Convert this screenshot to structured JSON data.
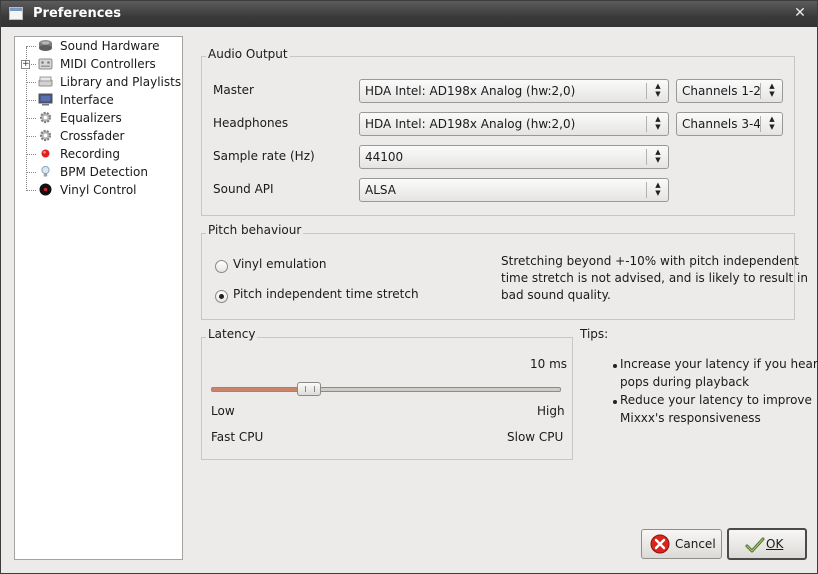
{
  "window": {
    "title": "Preferences",
    "close_glyph": "✕"
  },
  "sidebar": {
    "items": [
      {
        "label": "Sound Hardware",
        "icon": "speaker-icon"
      },
      {
        "label": "MIDI Controllers",
        "icon": "midi-controller-icon",
        "expander": "+"
      },
      {
        "label": "Library and Playlists",
        "icon": "library-icon"
      },
      {
        "label": "Interface",
        "icon": "monitor-icon"
      },
      {
        "label": "Equalizers",
        "icon": "gear-icon"
      },
      {
        "label": "Crossfader",
        "icon": "gear-icon"
      },
      {
        "label": "Recording",
        "icon": "record-dot-icon"
      },
      {
        "label": "BPM Detection",
        "icon": "lightbulb-icon"
      },
      {
        "label": "Vinyl Control",
        "icon": "vinyl-record-icon"
      }
    ],
    "selected_index": 0
  },
  "audio_output": {
    "group_title": "Audio Output",
    "master": {
      "label": "Master",
      "device": "HDA Intel: AD198x Analog (hw:2,0)",
      "channels": "Channels 1-2"
    },
    "headphones": {
      "label": "Headphones",
      "device": "HDA Intel: AD198x Analog (hw:2,0)",
      "channels": "Channels 3-4"
    },
    "sample_rate": {
      "label": "Sample rate (Hz)",
      "value": "44100"
    },
    "sound_api": {
      "label": "Sound API",
      "value": "ALSA"
    }
  },
  "pitch": {
    "group_title": "Pitch behaviour",
    "options": [
      {
        "label": "Vinyl emulation",
        "checked": false
      },
      {
        "label": "Pitch independent time stretch",
        "checked": true
      }
    ],
    "note_lines": [
      "Stretching beyond +-10% with pitch independent",
      "time stretch is not advised, and is likely to result in",
      "bad sound quality."
    ]
  },
  "latency": {
    "group_title": "Latency",
    "value_text": "10 ms",
    "slider_fraction": 0.28,
    "low": "Low",
    "high": "High",
    "fast": "Fast CPU",
    "slow": "Slow CPU"
  },
  "tips": {
    "title": "Tips:",
    "items": [
      {
        "line1": "Increase your latency if you hear",
        "line2": "pops during playback"
      },
      {
        "line1": "Reduce your latency to improve",
        "line2": "Mixxx's responsiveness"
      }
    ]
  },
  "buttons": {
    "cancel": "Cancel",
    "ok": "OK"
  },
  "colors": {
    "slider_fill": "#c9846a",
    "cancel_icon": "#d9261c",
    "record_dot": "#e02020"
  }
}
